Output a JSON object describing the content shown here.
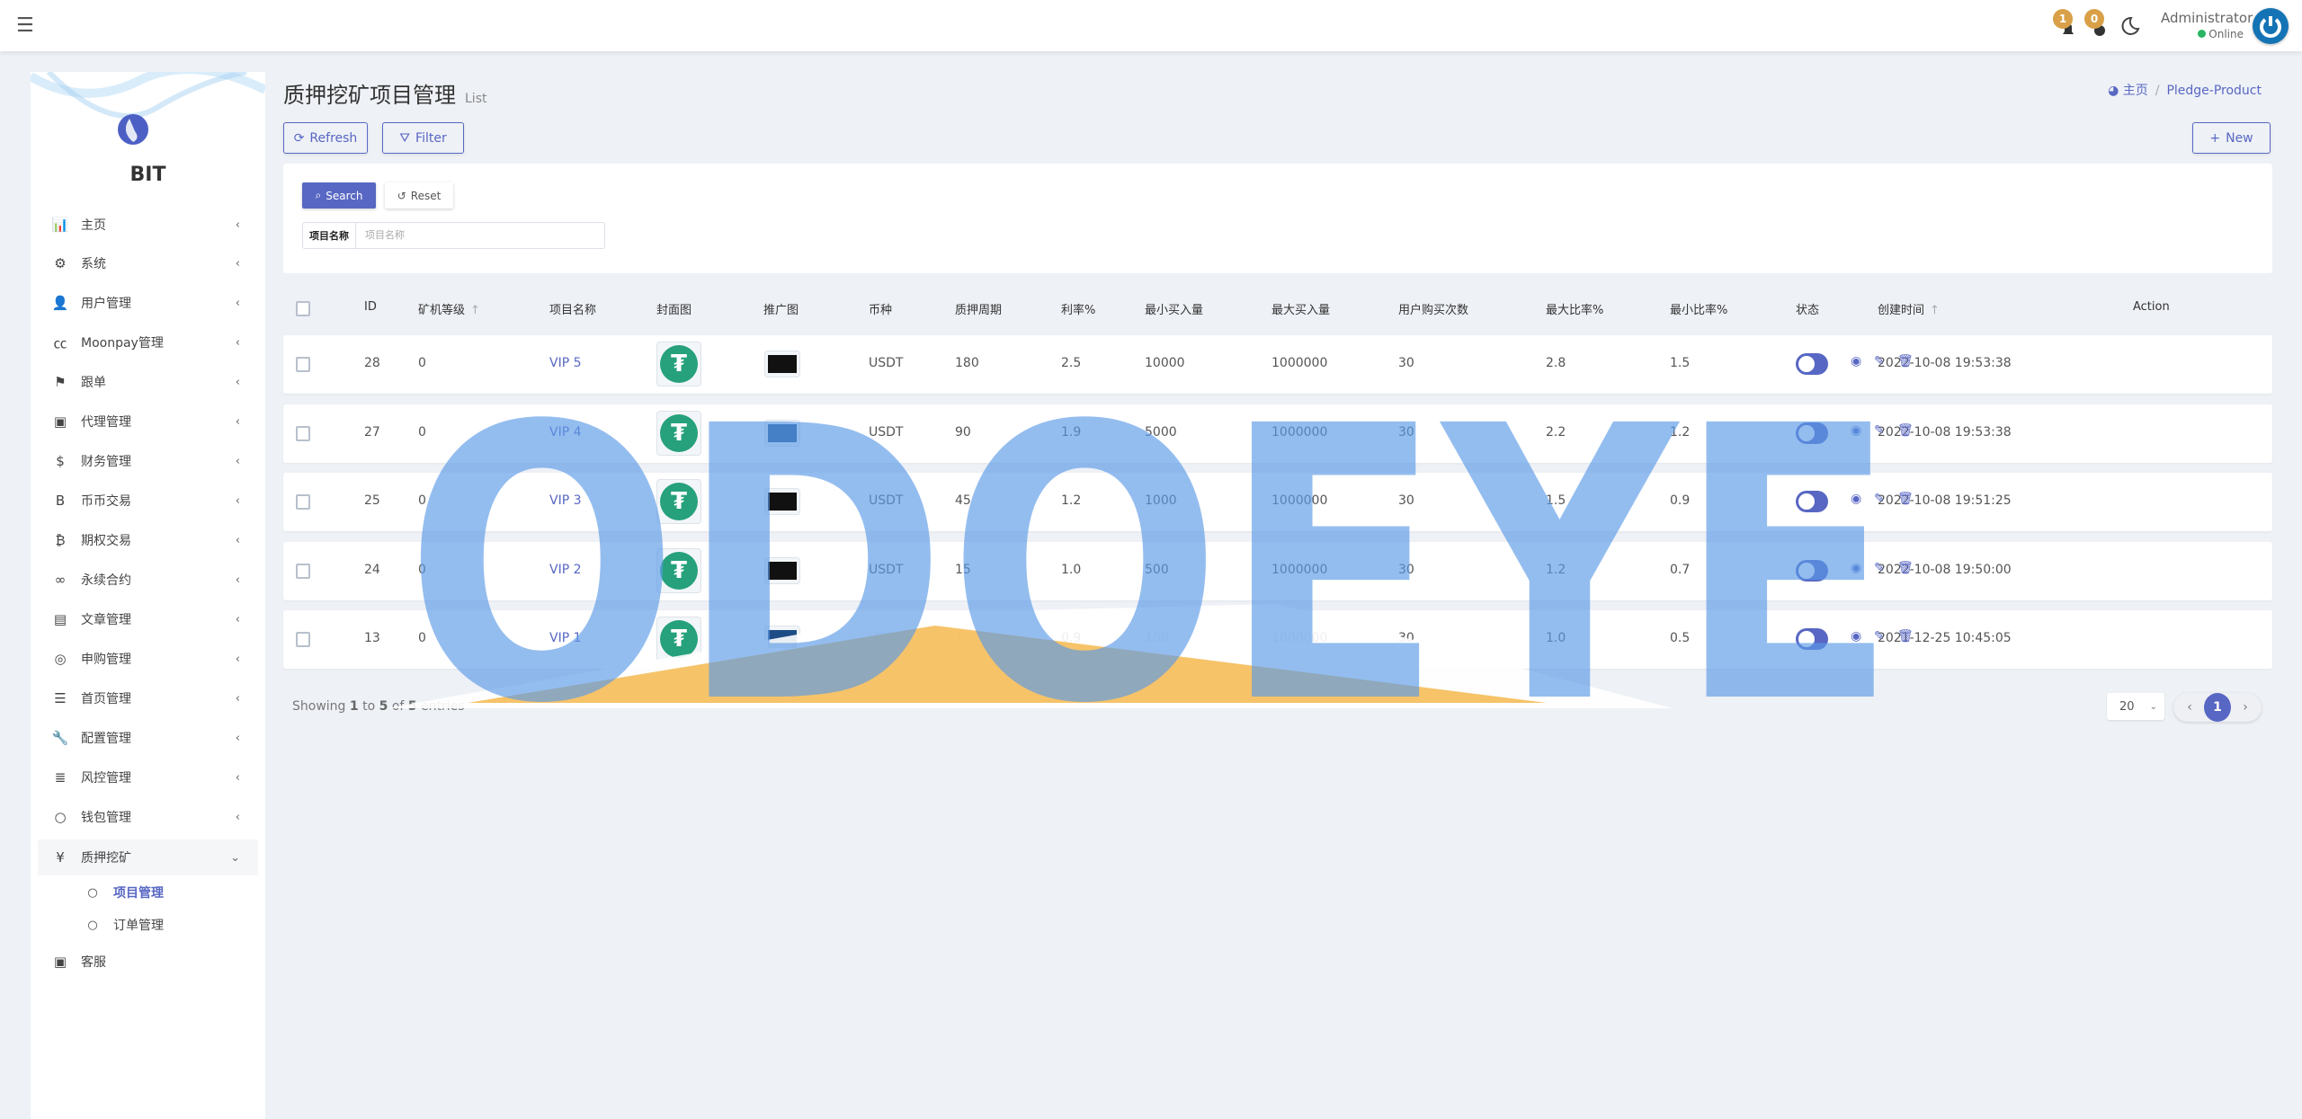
{
  "header": {
    "admin_name": "Administrator",
    "admin_status": "Online",
    "notifications": [
      {
        "icon": "bell-icon",
        "count": "1"
      },
      {
        "icon": "message-icon",
        "count": "0"
      }
    ],
    "theme_icon": "moon-icon"
  },
  "sidebar": {
    "brand": "BIT",
    "items": [
      {
        "icon": "chart-bar-icon",
        "glyph": "📊",
        "label": "主页"
      },
      {
        "icon": "gear-icon",
        "glyph": "⚙",
        "label": "系统"
      },
      {
        "icon": "user-tie-icon",
        "glyph": "👤",
        "label": "用户管理"
      },
      {
        "icon": "cc-icon",
        "glyph": "㏄",
        "label": "Moonpay管理"
      },
      {
        "icon": "flag-icon",
        "glyph": "⚑",
        "label": "跟单"
      },
      {
        "icon": "id-card-icon",
        "glyph": "▣",
        "label": "代理管理"
      },
      {
        "icon": "dollar-icon",
        "glyph": "$",
        "label": "财务管理"
      },
      {
        "icon": "bold-b-icon",
        "glyph": "B",
        "label": "币币交易"
      },
      {
        "icon": "bitcoin-icon",
        "glyph": "₿",
        "label": "期权交易"
      },
      {
        "icon": "link-icon",
        "glyph": "∞",
        "label": "永续合约"
      },
      {
        "icon": "newspaper-icon",
        "glyph": "▤",
        "label": "文章管理"
      },
      {
        "icon": "life-ring-icon",
        "glyph": "◎",
        "label": "申购管理"
      },
      {
        "icon": "bars-icon",
        "glyph": "☰",
        "label": "首页管理"
      },
      {
        "icon": "wrench-icon",
        "glyph": "🔧",
        "label": "配置管理"
      },
      {
        "icon": "indent-icon",
        "glyph": "≣",
        "label": "风控管理"
      },
      {
        "icon": "circle-icon",
        "glyph": "○",
        "label": "钱包管理"
      },
      {
        "icon": "yen-icon",
        "glyph": "¥",
        "label": "质押挖矿"
      }
    ],
    "subitems": [
      {
        "label": "项目管理",
        "active": true
      },
      {
        "label": "订单管理",
        "active": false
      }
    ],
    "last": {
      "icon": "id-card-icon",
      "glyph": "▣",
      "label": "客服"
    }
  },
  "page": {
    "title": "质押挖矿项目管理",
    "subtitle": "List",
    "breadcrumb_home": "主页",
    "breadcrumb_current": "Pledge-Product"
  },
  "toolbar": {
    "refresh": "Refresh",
    "filter": "Filter",
    "new": "New"
  },
  "search": {
    "search": "Search",
    "reset": "Reset",
    "field_label": "项目名称",
    "field_placeholder": "项目名称",
    "field_value": ""
  },
  "table": {
    "columns": [
      "ID",
      "矿机等级",
      "项目名称",
      "封面图",
      "推广图",
      "币种",
      "质押周期",
      "利率%",
      "最小买入量",
      "最大买入量",
      "用户购买次数",
      "最大比率%",
      "最小比率%",
      "状态",
      "创建时间",
      "Action"
    ],
    "rows": [
      {
        "id": "28",
        "level": "0",
        "name": "VIP 5",
        "promo": "#111111",
        "coin": "USDT",
        "period": "180",
        "rate": "2.5",
        "min": "10000",
        "max": "1000000",
        "times": "30",
        "max_ratio": "2.8",
        "min_ratio": "1.5",
        "created": "2022-10-08 19:53:38"
      },
      {
        "id": "27",
        "level": "0",
        "name": "VIP 4",
        "promo": "#1d4b86",
        "coin": "USDT",
        "period": "90",
        "rate": "1.9",
        "min": "5000",
        "max": "1000000",
        "times": "30",
        "max_ratio": "2.2",
        "min_ratio": "1.2",
        "created": "2022-10-08 19:53:38"
      },
      {
        "id": "25",
        "level": "0",
        "name": "VIP 3",
        "promo": "#111111",
        "coin": "USDT",
        "period": "45",
        "rate": "1.2",
        "min": "1000",
        "max": "1000000",
        "times": "30",
        "max_ratio": "1.5",
        "min_ratio": "0.9",
        "created": "2022-10-08 19:51:25"
      },
      {
        "id": "24",
        "level": "0",
        "name": "VIP 2",
        "promo": "#111111",
        "coin": "USDT",
        "period": "15",
        "rate": "1.0",
        "min": "500",
        "max": "1000000",
        "times": "30",
        "max_ratio": "1.2",
        "min_ratio": "0.7",
        "created": "2022-10-08 19:50:00"
      },
      {
        "id": "13",
        "level": "0",
        "name": "VIP 1",
        "promo": "#1d4b86",
        "coin": "USDT",
        "period": "1",
        "rate": "0.9",
        "min": "100",
        "max": "1000000",
        "times": "30",
        "max_ratio": "1.0",
        "min_ratio": "0.5",
        "created": "2021-12-25 10:45:05"
      }
    ]
  },
  "footer": {
    "showing_prefix": "Showing",
    "from": "1",
    "to_word": "to",
    "to": "5",
    "of_word": "of",
    "total": "5",
    "suffix": "entries",
    "page_size": "20",
    "current_page": "1"
  },
  "watermark": {
    "text": "ODOEYE",
    "color": "#5b9be8",
    "accent": "#f5b94f"
  },
  "colors": {
    "accent": "#5867c3",
    "online": "#28b463",
    "badge": "#d9a047",
    "usdt": "#26a17b"
  }
}
